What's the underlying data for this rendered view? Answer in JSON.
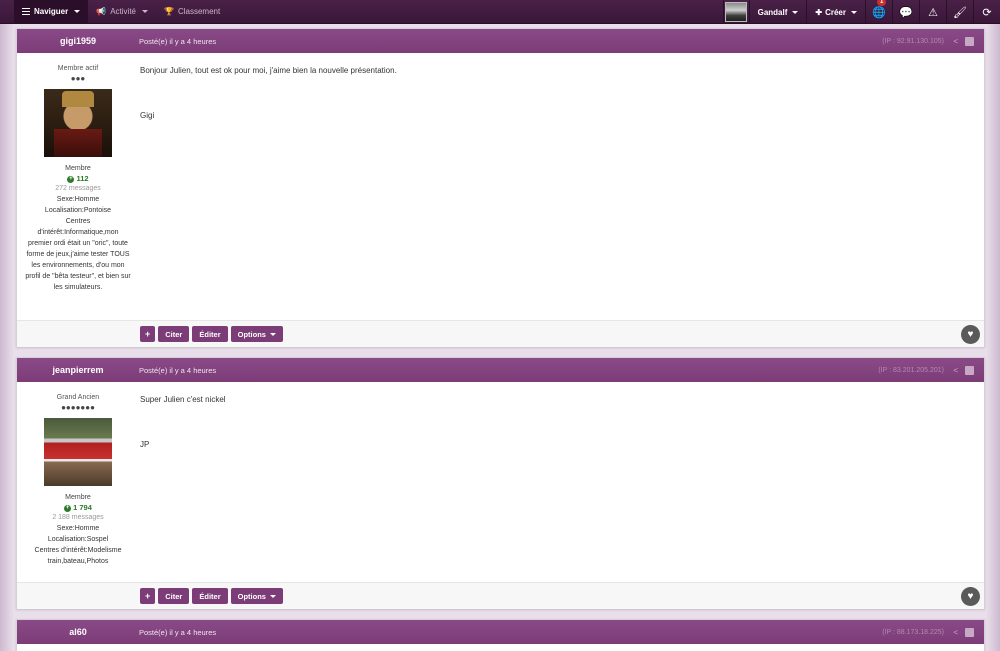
{
  "navbar": {
    "browse_label": "Naviguer",
    "activity_label": "Activité",
    "ranking_label": "Classement",
    "user_label": "Gandalf",
    "create_label": "Créer",
    "notifications_count": "1"
  },
  "posts": [
    {
      "author": "gigi1959",
      "posted": "Posté(e) il y a 4 heures",
      "ip": "(IP : 92.91.130.105)",
      "rank_title": "Membre actif",
      "pips": "●●●",
      "group": "Membre",
      "reputation": "112",
      "messages": "272 messages",
      "info": "Sexe:Homme\nLocalisation:Pontoise\nCentres d'intérêt:Informatique,mon premier ordi était un \"oric\", toute forme de jeux,j'aime tester TOUS les environnements, d'ou mon profil de \"bêta testeur\", et bien sur les simulateurs.",
      "content": [
        "Bonjour Julien, tout est ok pour moi, j'aime bien la nouvelle présentation.",
        "Gigi"
      ]
    },
    {
      "author": "jeanpierrem",
      "posted": "Posté(e) il y a 4 heures",
      "ip": "(IP : 83.201.205.201)",
      "rank_title": "Grand Ancien",
      "pips": "●●●●●●●",
      "group": "Membre",
      "reputation": "1 794",
      "messages": "2 188 messages",
      "info": "Sexe:Homme\nLocalisation:Sospel\nCentres d'intérêt:Modelisme train,bateau,Photos",
      "content": [
        "Super Julien c'est nickel",
        "JP"
      ]
    },
    {
      "author": "al60",
      "posted": "Posté(e) il y a 4 heures",
      "ip": "(IP : 88.173.18.225)"
    }
  ],
  "actions": {
    "plus": "+",
    "quote": "Citer",
    "edit": "Éditer",
    "options": "Options"
  },
  "colors": {
    "primary": "#7b3c78",
    "navbar": "#3a1739"
  }
}
